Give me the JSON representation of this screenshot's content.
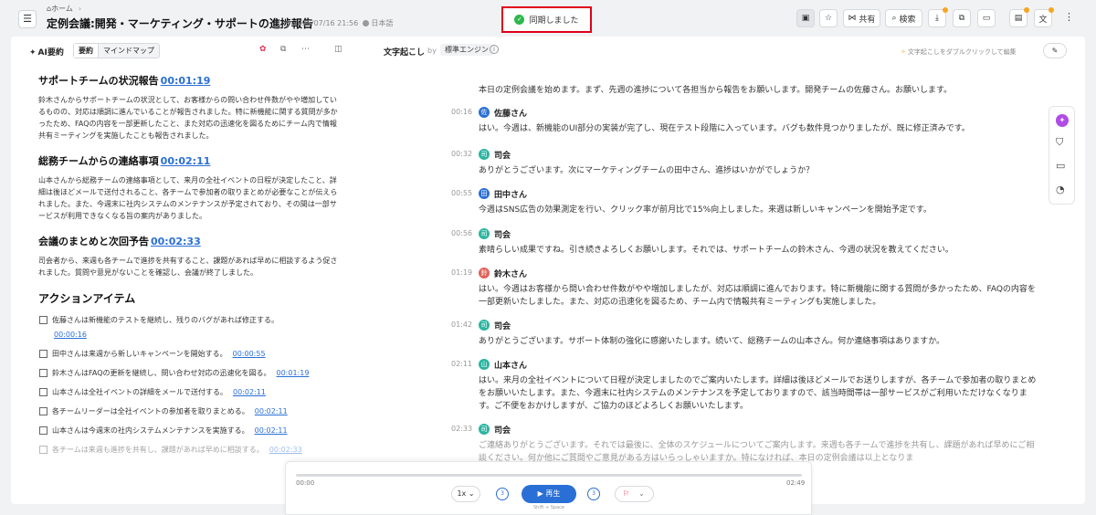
{
  "header": {
    "breadcrumb_home": "ホーム",
    "title": "定例会議:開発・マーケティング・サポートの進捗報告",
    "datetime": "2025/07/16 21:56",
    "language": "日本語",
    "sync_status": "同期しました",
    "share_label": "共有",
    "search_label": "検索"
  },
  "summary": {
    "title": "AI要約",
    "tab_summary": "要約",
    "tab_mindmap": "マインドマップ",
    "sections": [
      {
        "heading": "サポートチームの状況報告",
        "time": "00:01:19",
        "body": "鈴木さんからサポートチームの状況として、お客様からの問い合わせ件数がやや増加しているものの、対応は順調に進んでいることが報告されました。特に新機能に関する質問が多かったため、FAQの内容を一部更新したこと、また対応の迅速化を図るためにチーム内で情報共有ミーティングを実施したことも報告されました。"
      },
      {
        "heading": "総務チームからの連絡事項",
        "time": "00:02:11",
        "body": "山本さんから総務チームの連絡事項として、来月の全社イベントの日程が決定したこと、詳細は後ほどメールで送付されること、各チームで参加者の取りまとめが必要なことが伝えられました。また、今週末に社内システムのメンテナンスが予定されており、その間は一部サービスが利用できなくなる旨の案内がありました。"
      },
      {
        "heading": "会議のまとめと次回予告",
        "time": "00:02:33",
        "body": "司会者から、来週も各チームで進捗を共有すること、課題があれば早めに相談するよう促されました。質問や意見がないことを確認し、会議が終了しました。"
      }
    ],
    "actions_title": "アクションアイテム",
    "actions": [
      {
        "text": "佐藤さんは新機能のテストを継続し、残りのバグがあれば修正する。",
        "time": "00:00:16"
      },
      {
        "text": "田中さんは来週から新しいキャンペーンを開始する。",
        "time": "00:00:55"
      },
      {
        "text": "鈴木さんはFAQの更新を継続し、問い合わせ対応の迅速化を図る。",
        "time": "00:01:19"
      },
      {
        "text": "山本さんは全社イベントの詳細をメールで送付する。",
        "time": "00:02:11"
      },
      {
        "text": "各チームリーダーは全社イベントの参加者を取りまとめる。",
        "time": "00:02:11"
      },
      {
        "text": "山本さんは今週末の社内システムメンテナンスを実施する。",
        "time": "00:02:11"
      },
      {
        "text": "各チームは来週も進捗を共有し、課題があれば早めに相談する。",
        "time": "00:02:33"
      }
    ]
  },
  "transcript": {
    "title": "文字起こし",
    "by": "by",
    "engine": "標準エンジン",
    "hint": "文字起こしをダブルクリックして編集",
    "utterances": [
      {
        "time": "",
        "speaker": "",
        "avatar": "",
        "color": "#2bb5a0",
        "text": "本日の定例会議を始めます。まず、先週の進捗について各担当から報告をお願いします。開発チームの佐藤さん。お願いします。"
      },
      {
        "time": "00:16",
        "speaker": "佐藤さん",
        "avatar": "佐",
        "color": "#2a6fd6",
        "text": "はい。今週は、新機能のUI部分の実装が完了し、現在テスト段階に入っています。バグも数件見つかりましたが、既に修正済みです。"
      },
      {
        "time": "00:32",
        "speaker": "司会",
        "avatar": "司",
        "color": "#2bb5a0",
        "text": "ありがとうございます。次にマーケティングチームの田中さん、進捗はいかがでしょうか？"
      },
      {
        "time": "00:55",
        "speaker": "田中さん",
        "avatar": "田",
        "color": "#2a6fd6",
        "text": "今週はSNS広告の効果測定を行い、クリック率が前月比で15%向上しました。来週は新しいキャンペーンを開始予定です。"
      },
      {
        "time": "00:56",
        "speaker": "司会",
        "avatar": "司",
        "color": "#2bb5a0",
        "text": "素晴らしい成果ですね。引き続きよろしくお願いします。それでは、サポートチームの鈴木さん、今週の状況を教えてください。"
      },
      {
        "time": "01:19",
        "speaker": "鈴木さん",
        "avatar": "鈴",
        "color": "#e0625a",
        "text": "はい。今週はお客様から問い合わせ件数がやや増加しましたが、対応は順調に進んでおります。特に新機能に関する質問が多かったため、FAQの内容を一部更新いたしました。また、対応の迅速化を図るため、チーム内で情報共有ミーティングも実施しました。"
      },
      {
        "time": "01:42",
        "speaker": "司会",
        "avatar": "司",
        "color": "#2bb5a0",
        "text": "ありがとうございます。サポート体制の強化に感謝いたします。続いて、総務チームの山本さん。何か連絡事項はありますか。"
      },
      {
        "time": "02:11",
        "speaker": "山本さん",
        "avatar": "山",
        "color": "#2bb5a0",
        "text": "はい。来月の全社イベントについて日程が決定しましたのでご案内いたします。詳細は後ほどメールでお送りしますが、各チームで参加者の取りまとめをお願いいたします。また、今週末に社内システムのメンテナンスを予定しておりますので、該当時間帯は一部サービスがご利用いただけなくなります。ご不便をおかけしますが、ご協力のほどよろしくお願いいたします。"
      },
      {
        "time": "02:33",
        "speaker": "司会",
        "avatar": "司",
        "color": "#2bb5a0",
        "text": "ご連絡ありがとうございます。それでは最後に、全体のスケジュールについてご案内します。来週も各チームで進捗を共有し、課題があれば早めにご相談ください。何か他にご質問やご意見がある方はいらっしゃいますか。特になければ、本日の定例会議は以上となりま"
      }
    ]
  },
  "player": {
    "current": "00:00",
    "total": "02:49",
    "speed": "1x",
    "skip_back": "3",
    "skip_fwd": "3",
    "play_label": "再生",
    "shortcut": "Shift + Space"
  }
}
